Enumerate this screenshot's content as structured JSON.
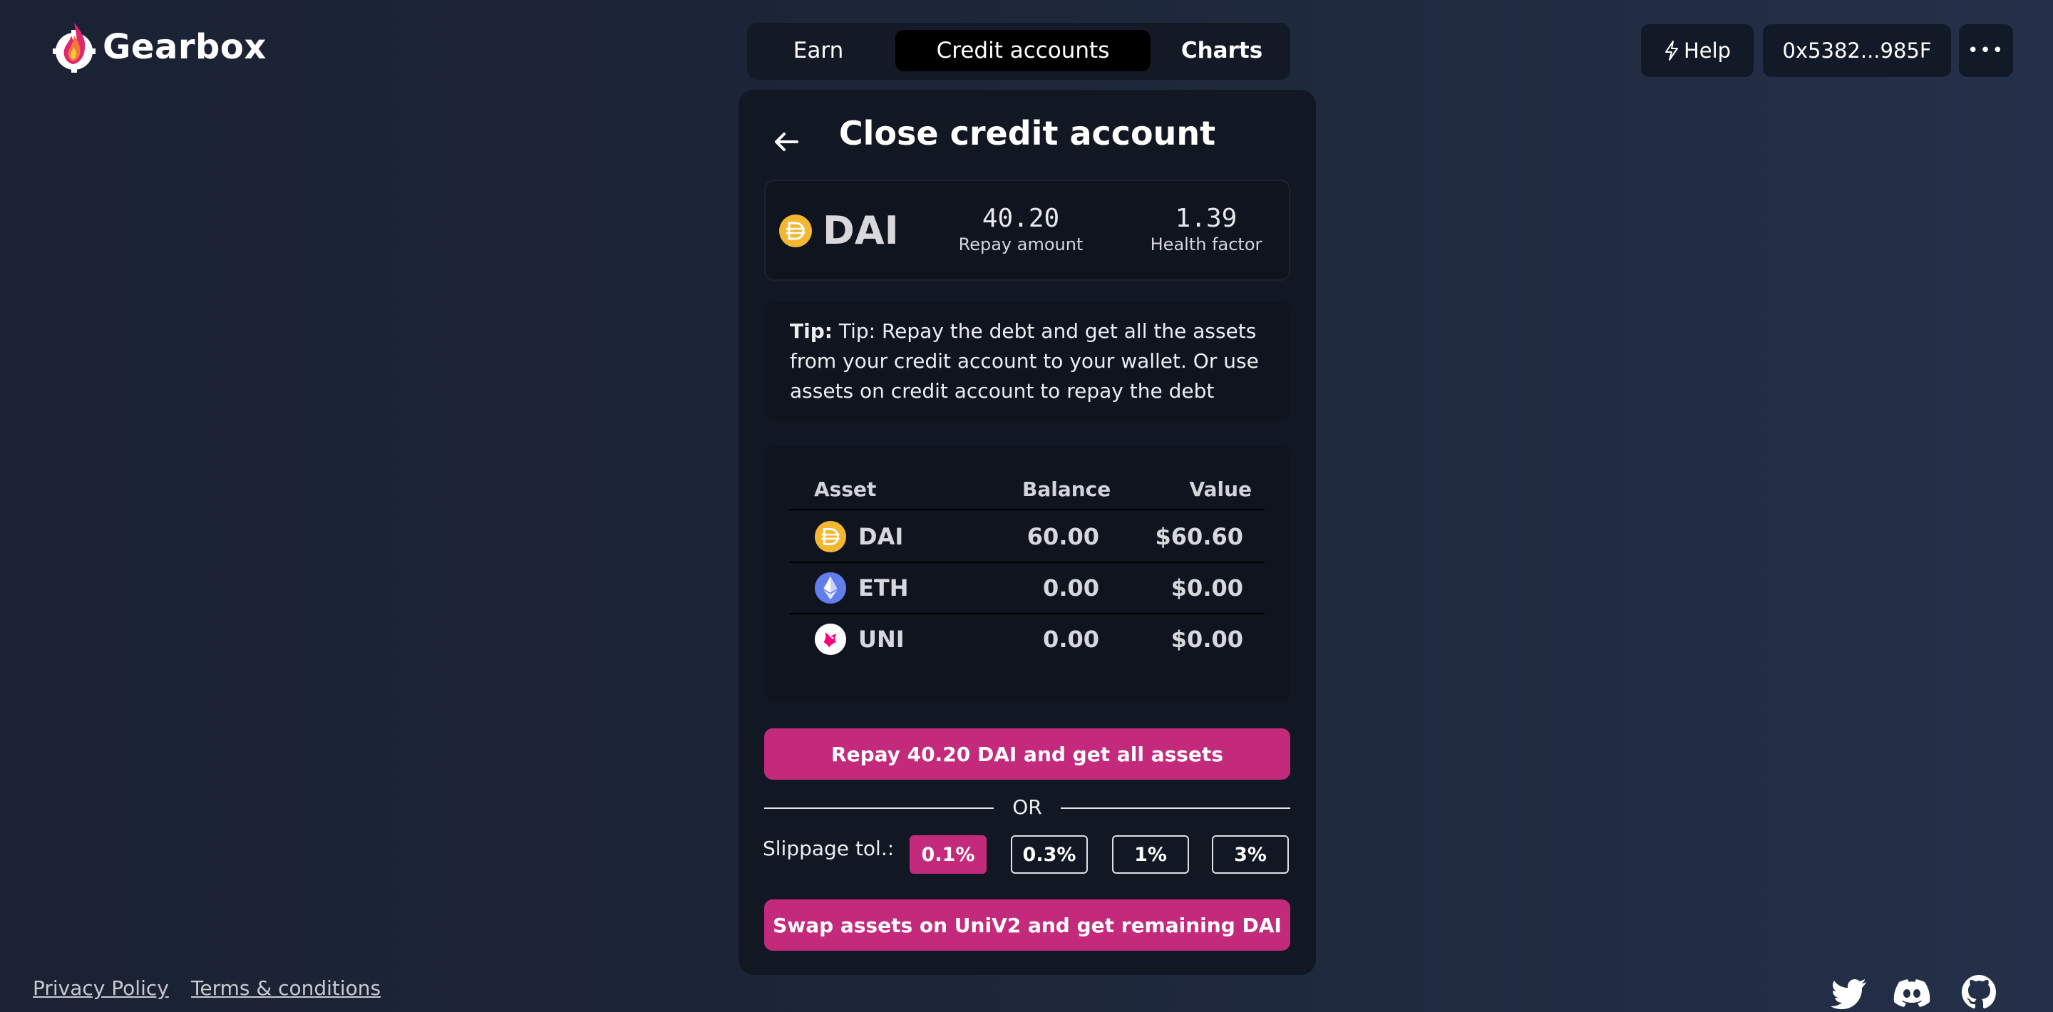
{
  "brand": {
    "name": "Gearbox",
    "logo_icon": "gearbox-flame-logo"
  },
  "nav": {
    "tabs": [
      {
        "label": "Earn"
      },
      {
        "label": "Credit accounts"
      },
      {
        "label": "Charts"
      }
    ],
    "active": "Credit accounts"
  },
  "header": {
    "help_label": "Help",
    "help_icon": "lightning-icon",
    "wallet_address": "0x5382...985F",
    "more_label": "•••"
  },
  "panel": {
    "title": "Close credit account",
    "summary": {
      "symbol": "DAI",
      "repay_amount": "40.20",
      "repay_label": "Repay amount",
      "health_factor": "1.39",
      "health_label": "Health factor"
    },
    "tip": {
      "prefix": "Tip:",
      "text": "Tip: Repay the debt and get all the assets from your credit account to your wallet. Or use assets on credit account to repay the debt"
    },
    "assets": {
      "columns": [
        "Asset",
        "Balance",
        "Value"
      ],
      "rows": [
        {
          "symbol": "DAI",
          "balance": "60.00",
          "value": "$60.60",
          "icon": "dai-icon"
        },
        {
          "symbol": "ETH",
          "balance": "0.00",
          "value": "$0.00",
          "icon": "eth-icon"
        },
        {
          "symbol": "UNI",
          "balance": "0.00",
          "value": "$0.00",
          "icon": "uni-icon"
        }
      ]
    },
    "repay_button": "Repay 40.20 DAI and get all assets",
    "or_label": "OR",
    "slippage": {
      "label": "Slippage tol.:",
      "options": [
        "0.1%",
        "0.3%",
        "1%",
        "3%"
      ],
      "selected": "0.1%"
    },
    "swap_button": "Swap assets on UniV2 and get remaining DAI"
  },
  "footer": {
    "links": [
      "Privacy Policy",
      "Terms & conditions"
    ],
    "social_icons": [
      "twitter-icon",
      "discord-icon",
      "github-icon"
    ]
  },
  "colors": {
    "accent": "#c42a7c",
    "panel_bg": "#111723",
    "card_bg": "#0f141e",
    "dai": "#f4b731",
    "eth": "#627eea"
  }
}
